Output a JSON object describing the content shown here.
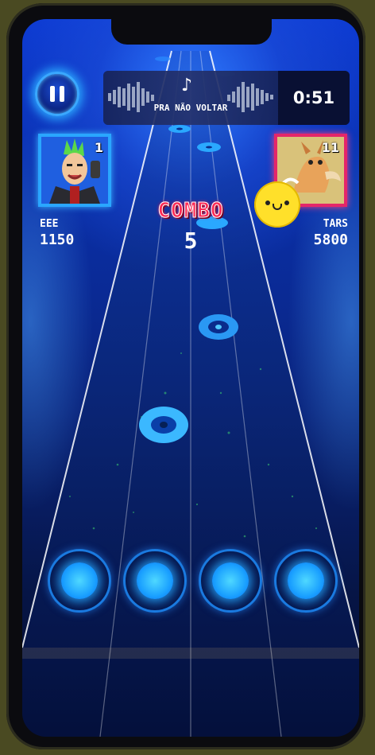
{
  "song": {
    "title": "PRA NÃO VOLTAR",
    "time_remaining": "0:51",
    "note_icon": "music-note-icon"
  },
  "players": [
    {
      "name": "EEE",
      "score": "1150",
      "rank": "1",
      "frame_color": "#2aa6ff"
    },
    {
      "name": "TARS",
      "score": "5800",
      "rank": "11",
      "frame_color": "#e4266a"
    }
  ],
  "combo": {
    "label": "COMBO",
    "count": "5"
  },
  "colors": {
    "background": "#0a2fa8",
    "combo": "#ff2a55",
    "lane_button": "#1aa0ff"
  },
  "controls": {
    "pause_icon": "pause-icon",
    "lanes": 4
  }
}
